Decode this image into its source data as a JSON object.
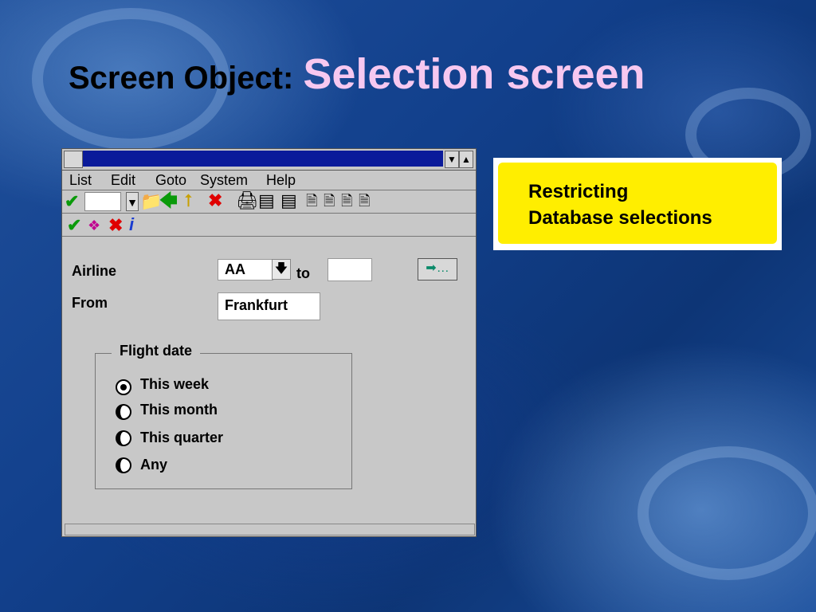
{
  "slide": {
    "title_prefix": "Screen Object:",
    "title_main": "Selection screen"
  },
  "menu": [
    "List",
    "Edit",
    "Goto",
    "System",
    "Help"
  ],
  "form": {
    "airline_label": "Airline",
    "airline_from": "AA",
    "to_label": "to",
    "airline_to": "",
    "from_label": "From",
    "from_value": "Frankfurt"
  },
  "flight_date": {
    "legend": "Flight date",
    "options": [
      "This week",
      "This month",
      "This quarter",
      "Any"
    ],
    "selected": "This week"
  },
  "callout": {
    "line1": "Restricting",
    "line2": "Database selections"
  },
  "icons": {
    "toolbar1": [
      "enter-check-icon",
      "save-icon",
      "back-arrow-icon",
      "exit-icon",
      "cancel-icon",
      "print-icon",
      "find-icon",
      "find-next-icon",
      "first-page-icon",
      "previous-page-icon",
      "next-page-icon",
      "last-page-icon"
    ],
    "toolbar2": [
      "execute-icon",
      "get-variant-icon",
      "delete-selection-icon",
      "info-icon"
    ],
    "multiple_selection": "multiple-selection-icon"
  },
  "colors": {
    "title_main": "#f7c8f0",
    "window_title_bar": "#0a1a9a",
    "callout_highlight": "#ffee00"
  }
}
